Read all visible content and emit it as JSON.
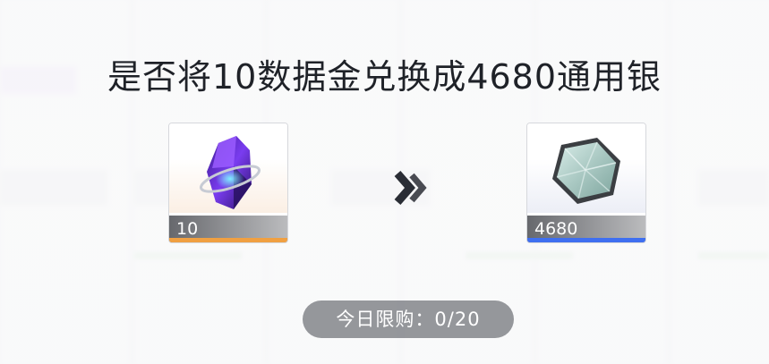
{
  "dialog": {
    "title": "是否将10数据金兑换成4680通用银"
  },
  "from_item": {
    "name": "数据金",
    "icon": "purple-crystal-icon",
    "quantity": "10",
    "rarity_color": "#f0a042"
  },
  "to_item": {
    "name": "通用银",
    "icon": "silver-hexagon-icon",
    "quantity": "4680",
    "rarity_color": "#3f6ff0"
  },
  "arrow_icon": "double-chevron-right-icon",
  "daily_limit": {
    "text": "今日限购：0/20"
  }
}
